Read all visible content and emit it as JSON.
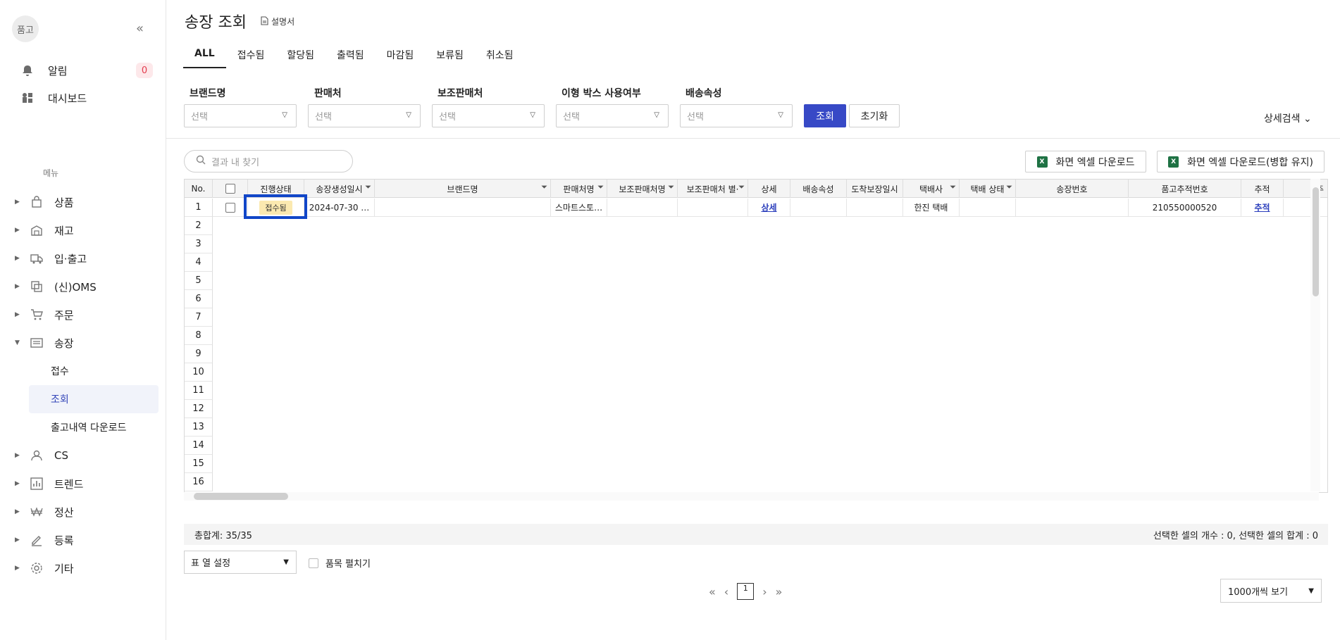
{
  "sidebar": {
    "logo": "품고",
    "alerts_label": "알림",
    "alerts_count": "0",
    "dashboard_label": "대시보드",
    "menu_title": "메뉴",
    "nav": [
      {
        "label": "상품",
        "icon": "bag-icon"
      },
      {
        "label": "재고",
        "icon": "warehouse-icon"
      },
      {
        "label": "입·출고",
        "icon": "truck-icon"
      },
      {
        "label": "(신)OMS",
        "icon": "oms-icon"
      },
      {
        "label": "주문",
        "icon": "cart-icon"
      },
      {
        "label": "송장",
        "icon": "invoice-icon"
      },
      {
        "label": "CS",
        "icon": "person-icon"
      },
      {
        "label": "트렌드",
        "icon": "chart-icon"
      },
      {
        "label": "정산",
        "icon": "won-icon"
      },
      {
        "label": "등록",
        "icon": "pen-icon"
      },
      {
        "label": "기타",
        "icon": "gear-icon"
      }
    ],
    "sub": [
      "접수",
      "조회",
      "출고내역 다운로드"
    ]
  },
  "header": {
    "title": "송장 조회",
    "manual": "설명서"
  },
  "tabs": [
    "ALL",
    "접수됨",
    "할당됨",
    "출력됨",
    "마감됨",
    "보류됨",
    "취소됨"
  ],
  "filters": [
    {
      "label": "브랜드명",
      "placeholder": "선택"
    },
    {
      "label": "판매처",
      "placeholder": "선택"
    },
    {
      "label": "보조판매처",
      "placeholder": "선택"
    },
    {
      "label": "이형 박스 사용여부",
      "placeholder": "선택"
    },
    {
      "label": "배송속성",
      "placeholder": "선택"
    }
  ],
  "buttons": {
    "search": "조회",
    "reset": "초기화",
    "detail_search": "상세검색",
    "excel": "화면 엑셀 다운로드",
    "excel_merge": "화면 엑셀 다운로드(병합 유지)"
  },
  "search_placeholder": "결과 내 찾기",
  "table": {
    "headers": [
      "No.",
      "",
      "진행상태",
      "송장생성일시",
      "브랜드명",
      "판매처명",
      "보조판매처명",
      "보조판매처 별·",
      "상세",
      "배송속성",
      "도착보장일시",
      "택배사",
      "택배 상태",
      "송장번호",
      "품고추적번호",
      "추적",
      "주"
    ],
    "row1": {
      "no": "1",
      "status": "접수됨",
      "created": "2024-07-30 …",
      "brand": "",
      "seller": "스마트스토…",
      "sub_seller": "",
      "sub_seller2": "",
      "detail": "상세",
      "attr": "",
      "arrival": "",
      "courier": "한진 택배",
      "courier_status": "",
      "invoice": "",
      "track_no": "210550000520",
      "track": "추적"
    },
    "row_numbers": [
      "2",
      "3",
      "4",
      "5",
      "6",
      "7",
      "8",
      "9",
      "10",
      "11",
      "12",
      "13",
      "14",
      "15",
      "16"
    ]
  },
  "summary": {
    "total": "총합계: 35/35",
    "selection": "선택한 셀의 개수 : 0, 선택한 셀의 합계 : 0"
  },
  "col_setting": "표 열 설정",
  "expand_items": "품목 펼치기",
  "page": "1",
  "per_page": "1000개씩 보기"
}
